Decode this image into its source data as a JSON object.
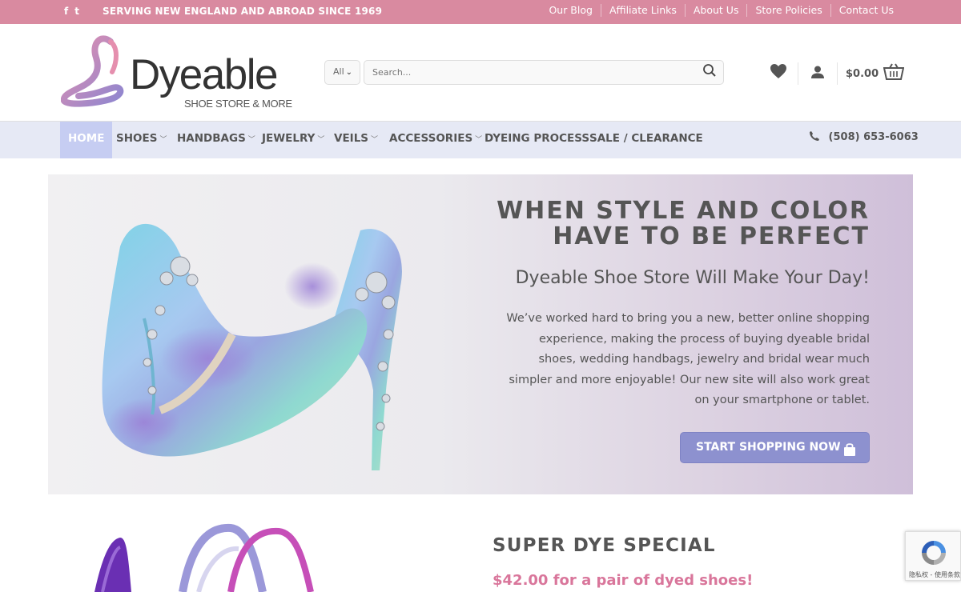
{
  "topbar": {
    "social": [
      "f",
      "t"
    ],
    "tagline": "SERVING NEW ENGLAND AND ABROAD SINCE 1969",
    "links": [
      "Our Blog",
      "Affiliate Links",
      "About Us",
      "Store Policies",
      "Contact Us"
    ]
  },
  "header": {
    "logo_text": "Dyeable",
    "logo_sub": "SHOE STORE & MORE",
    "search_category": "All",
    "search_placeholder": "Search...",
    "cart_total": "$0.00"
  },
  "nav": {
    "items": [
      "HOME",
      "SHOES",
      "HANDBAGS",
      "JEWELRY",
      "VEILS",
      "ACCESSORIES",
      "DYEING PROCESS",
      "SALE / CLEARANCE"
    ],
    "phone": "(508) 653-6063"
  },
  "hero": {
    "title_line1": "WHEN STYLE AND COLOR",
    "title_line2": "HAVE TO BE PERFECT",
    "subtitle": "Dyeable Shoe Store Will Make Your Day!",
    "body": "We’ve worked hard to bring you a new, better online shopping experience, making the process of buying dyeable bridal shoes, wedding handbags, jewelry and bridal wear much simpler and more enjoyable! Our new site will also work great on your smartphone or tablet.",
    "cta": "START SHOPPING NOW"
  },
  "special": {
    "title": "SUPER DYE SPECIAL",
    "price_text": "$42.00 for a pair of dyed shoes!"
  },
  "recaptcha": {
    "text": "隐私权 - 使用条款"
  },
  "colors": {
    "topbar": "#d98aa0",
    "nav_bg": "#e6e9f5",
    "nav_active": "#c6cdf2",
    "cta": "#8d91cf",
    "price": "#d9769b"
  },
  "icons": [
    "facebook-icon",
    "twitter-icon",
    "search-icon",
    "chevron-down-icon",
    "heart-icon",
    "user-icon",
    "cart-icon",
    "phone-icon",
    "shopping-bag-icon",
    "recaptcha-icon"
  ]
}
